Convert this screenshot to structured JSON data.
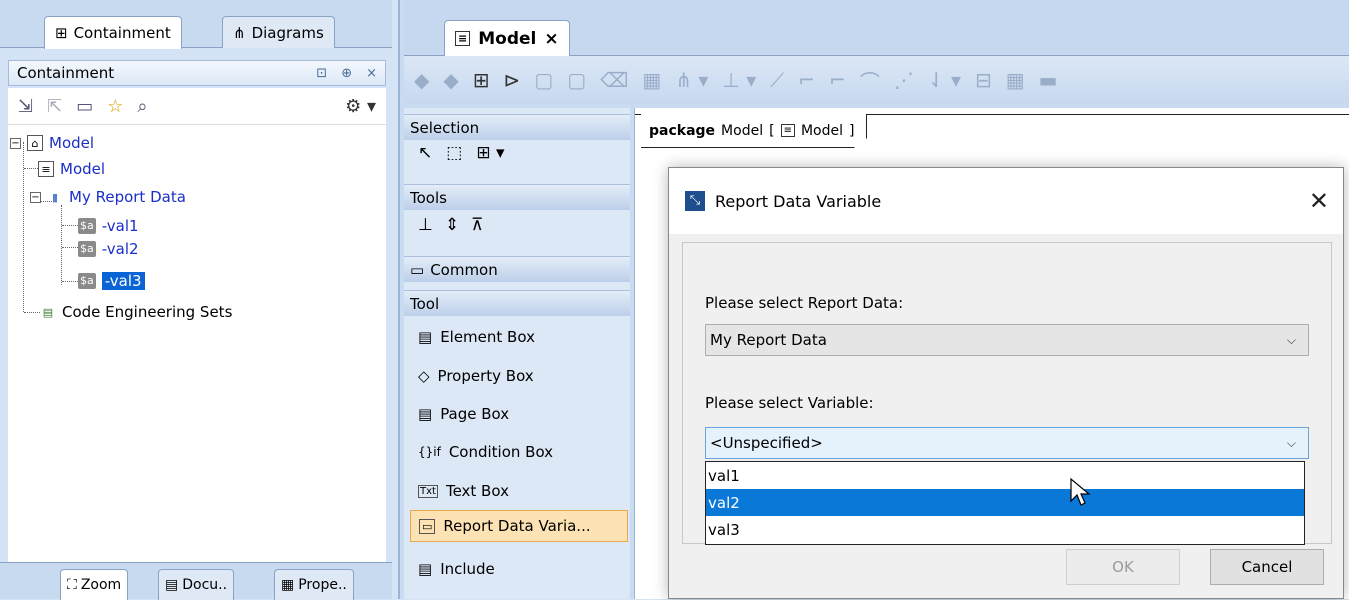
{
  "left_panel": {
    "tabs": [
      {
        "label": "Containment",
        "icon": "containment-icon"
      },
      {
        "label": "Diagrams",
        "icon": "diagrams-icon"
      }
    ],
    "title": "Containment",
    "title_controls": [
      "⊡",
      "⊕",
      "×"
    ],
    "tree": {
      "root": "Model",
      "model_child": "Model",
      "report_data": "My Report Data",
      "variables": [
        "-val1",
        "-val2",
        "-val3"
      ],
      "variable_tag": "$a",
      "code_sets": "Code Engineering Sets"
    },
    "bottom_tabs": [
      "Zoom",
      "Docu..",
      "Prope.."
    ]
  },
  "editor": {
    "tab_label": "Model",
    "tab_close": "×"
  },
  "palette": {
    "sections": {
      "selection": "Selection",
      "tools": "Tools",
      "common": "Common",
      "tool": "Tool"
    },
    "items": [
      "Element Box",
      "Property Box",
      "Page Box",
      "Condition Box",
      "Text Box",
      "Report Data Varia...",
      "Include"
    ]
  },
  "canvas": {
    "frame_keyword": "package",
    "frame_name": "Model",
    "frame_ref": "Model"
  },
  "dialog": {
    "title": "Report Data Variable",
    "report_label": "Please select Report Data:",
    "report_value": "My Report Data",
    "variable_label": "Please select Variable:",
    "variable_value": "<Unspecified>",
    "options": [
      "val1",
      "val2",
      "val3"
    ],
    "ok": "OK",
    "cancel": "Cancel"
  },
  "colors": {
    "selection_blue": "#0a78d7",
    "tree_text_blue": "#1a2fc9",
    "palette_highlight": "#fde3b4"
  }
}
